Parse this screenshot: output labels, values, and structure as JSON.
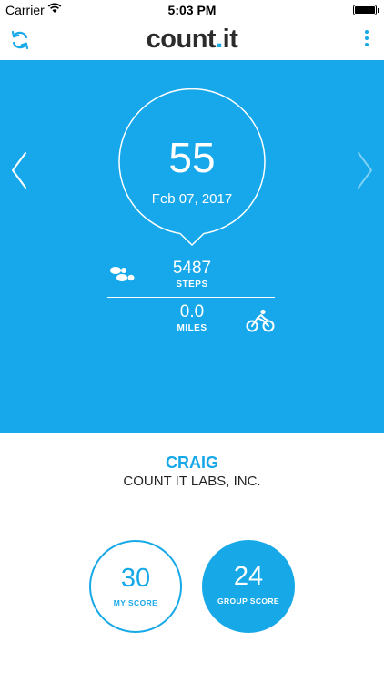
{
  "status_bar": {
    "carrier": "Carrier",
    "time": "5:03 PM",
    "battery_level": 1.0
  },
  "nav": {
    "logo_prefix": "count",
    "logo_dot": ".",
    "logo_suffix": "it",
    "left_icon": "refresh-icon",
    "right_icon": "more-vertical-icon"
  },
  "day": {
    "score": "55",
    "date": "Feb 07, 2017",
    "steps_value": "5487",
    "steps_label": "STEPS",
    "miles_value": "0.0",
    "miles_label": "MILES",
    "prev_icon": "chevron-left-icon",
    "next_icon": "chevron-right-icon",
    "steps_icon": "footprints-icon",
    "miles_icon": "cyclist-icon"
  },
  "profile": {
    "name": "CRAIG",
    "company": "COUNT IT LABS, INC."
  },
  "scores": {
    "my_score": "30",
    "my_score_label": "MY SCORE",
    "group_score": "24",
    "group_score_label": "GROUP SCORE"
  },
  "colors": {
    "accent": "#17a8e8",
    "hero_background": "#16a8ea",
    "text_dark": "#222222"
  }
}
